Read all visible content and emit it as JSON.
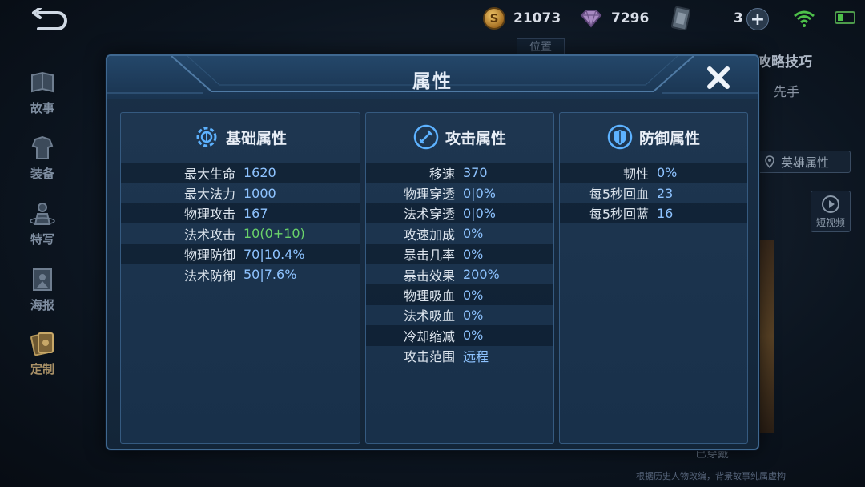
{
  "topbar": {
    "gold": "21073",
    "gems": "7296",
    "tickets": "3",
    "gold_symbol": "S"
  },
  "sidebar": {
    "items": [
      {
        "label": "故事"
      },
      {
        "label": "装备"
      },
      {
        "label": "特写"
      },
      {
        "label": "海报"
      },
      {
        "label": "定制"
      }
    ]
  },
  "background": {
    "guide": "攻略技巧",
    "first": "先手",
    "hero_attr": "英雄属性",
    "video": "短视频",
    "tab": "位置",
    "worn": "已穿戴",
    "note": "根据历史人物改编，背景故事纯属虚构"
  },
  "modal": {
    "title": "属性",
    "base": {
      "title": "基础属性",
      "rows": [
        {
          "label": "最大生命",
          "value": "1620"
        },
        {
          "label": "最大法力",
          "value": "1000"
        },
        {
          "label": "物理攻击",
          "value": "167"
        },
        {
          "label": "法术攻击",
          "value_a": "10(0+",
          "value_b": "10",
          "value_c": ")"
        },
        {
          "label": "物理防御",
          "value": "70|10.4%"
        },
        {
          "label": "法术防御",
          "value": "50|7.6%"
        }
      ]
    },
    "attack": {
      "title": "攻击属性",
      "rows": [
        {
          "label": "移速",
          "value": "370"
        },
        {
          "label": "物理穿透",
          "value": "0|0%"
        },
        {
          "label": "法术穿透",
          "value": "0|0%"
        },
        {
          "label": "攻速加成",
          "value": "0%"
        },
        {
          "label": "暴击几率",
          "value": "0%"
        },
        {
          "label": "暴击效果",
          "value": "200%"
        },
        {
          "label": "物理吸血",
          "value": "0%"
        },
        {
          "label": "法术吸血",
          "value": "0%"
        },
        {
          "label": "冷却缩减",
          "value": "0%"
        },
        {
          "label": "攻击范围",
          "value": "远程"
        }
      ]
    },
    "defense": {
      "title": "防御属性",
      "rows": [
        {
          "label": "韧性",
          "value": "0%"
        },
        {
          "label": "每5秒回血",
          "value": "23"
        },
        {
          "label": "每5秒回蓝",
          "value": "16"
        }
      ]
    }
  },
  "colors": {
    "value_blue": "#8ec3ff",
    "value_green": "#6ad36a",
    "panel_border": "#355a80"
  }
}
